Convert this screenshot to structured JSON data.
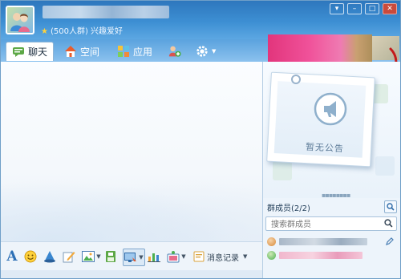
{
  "header": {
    "group_title": "",
    "group_info": "(500人群) 兴趣爱好",
    "star_icon": "star-icon"
  },
  "window_controls": [
    "minimize-icon",
    "maximize-icon",
    "close-icon"
  ],
  "tabs": [
    {
      "label": "聊天",
      "icon": "chat-icon",
      "active": true
    },
    {
      "label": "空间",
      "icon": "home-icon",
      "active": false
    },
    {
      "label": "应用",
      "icon": "apps-icon",
      "active": false
    }
  ],
  "toolbar": {
    "history_label": "消息记录",
    "icons": [
      "font-icon",
      "emoji-icon",
      "shake-icon",
      "edit-icon",
      "picture-icon",
      "screenshot-icon",
      "chart-icon",
      "gift-icon",
      "history-icon"
    ]
  },
  "notice": {
    "empty_text": "暂无公告"
  },
  "members": {
    "title": "群成员(2/2)",
    "search_placeholder": "搜索群成员",
    "count": 2
  },
  "colors": {
    "accent_blue": "#3d8fd3",
    "close_red": "#c94a3c",
    "banner_pink": "#e2357c"
  }
}
